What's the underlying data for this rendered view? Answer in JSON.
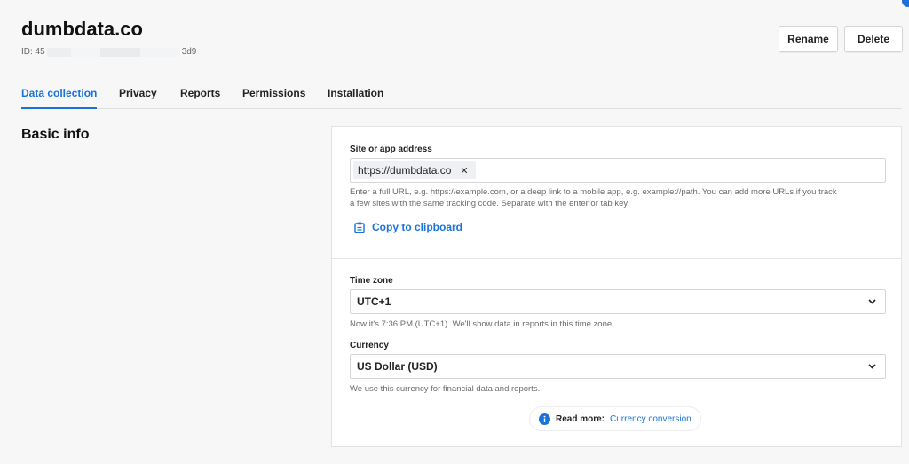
{
  "header": {
    "site_name": "dumbdata.co",
    "id_prefix": "ID: 45",
    "id_suffix": "3d9",
    "rename_label": "Rename",
    "delete_label": "Delete"
  },
  "tabs": [
    {
      "label": "Data collection",
      "active": true
    },
    {
      "label": "Privacy",
      "active": false
    },
    {
      "label": "Reports",
      "active": false
    },
    {
      "label": "Permissions",
      "active": false
    },
    {
      "label": "Installation",
      "active": false
    }
  ],
  "section": {
    "heading": "Basic info"
  },
  "site_address": {
    "label": "Site or app address",
    "url_chip": "https://dumbdata.co",
    "remove_glyph": "✕",
    "help_line1": "Enter a full URL, e.g. https://example.com, or a deep link to a mobile app, e.g. example://path. You can add more URLs if you track",
    "help_line2": "a few sites with the same tracking code. Separate with the enter or tab key.",
    "copy_label": "Copy to clipboard"
  },
  "timezone": {
    "label": "Time zone",
    "value": "UTC+1",
    "help": "Now it's 7:36 PM (UTC+1). We'll show data in reports in this time zone."
  },
  "currency": {
    "label": "Currency",
    "value": "US Dollar (USD)",
    "help": "We use this currency for financial data and reports."
  },
  "read_more": {
    "label": "Read more:",
    "link": "Currency conversion"
  },
  "icons": {
    "clipboard": "clipboard-icon",
    "chevron": "chevron-down-icon",
    "info": "info-icon"
  },
  "colors": {
    "accent": "#1a73d9",
    "background": "#f7f7f8",
    "panel": "#ffffff"
  }
}
